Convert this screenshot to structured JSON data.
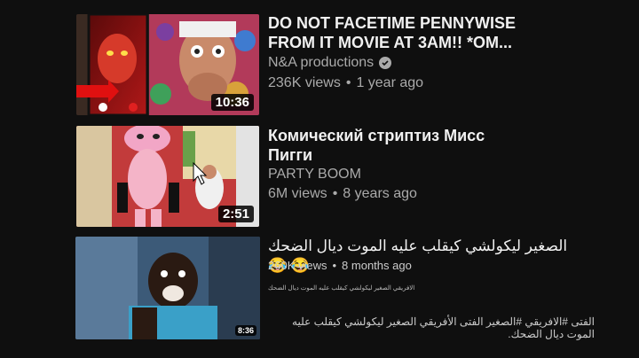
{
  "videos": [
    {
      "title": "DO NOT FACETIME PENNYWISE FROM IT MOVIE AT 3AM!! *OM...",
      "channel": "N&A productions",
      "views": "236K views",
      "age": "1 year ago",
      "duration": "10:36",
      "verified": true
    },
    {
      "title": "Комический стриптиз Мисс Пигги",
      "channel": "PARTY BOOM",
      "views": "6M views",
      "age": "8 years ago",
      "duration": "2:51"
    },
    {
      "title": "الصغير ليكولشي كيقلب عليه الموت ديال الضحك 😂 😂",
      "views": "260K views",
      "age": "8 months ago",
      "duration": "8:36",
      "small_caption": "الافريقي الصغير ليكولشي كيقلب عليه الموت ديال الضحك",
      "description": "الفتى #الافريقي #الصغير الفتى الأفريقي الصغير ليكولشي كيقلب عليه الموت ديال الضحك."
    }
  ],
  "colors": {
    "background": "#0f0f0f",
    "title": "#f1f1f1",
    "meta": "#aaaaaa"
  }
}
